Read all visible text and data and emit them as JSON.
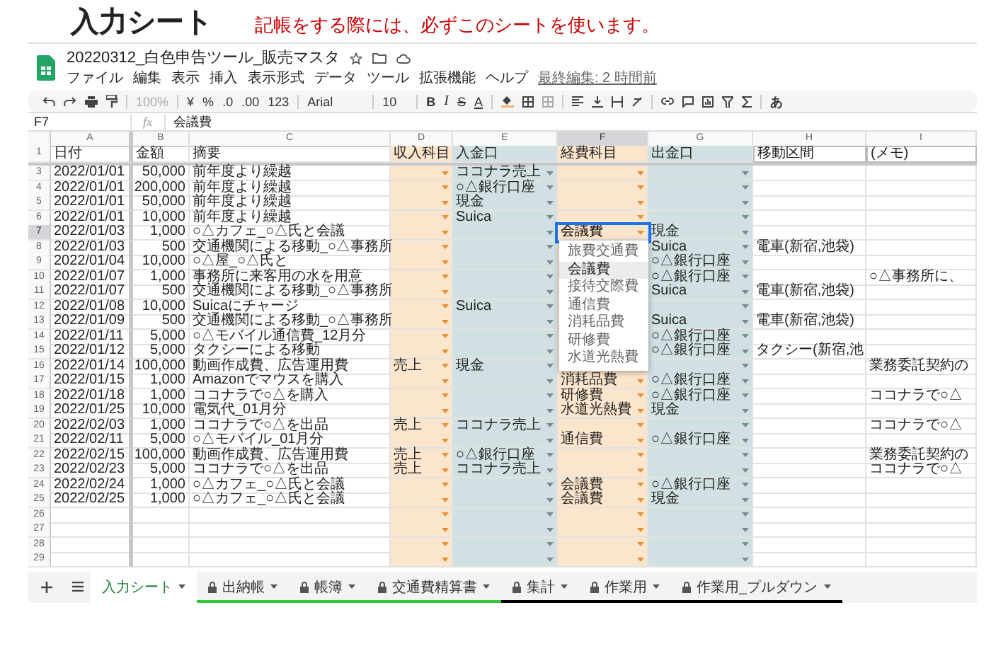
{
  "page": {
    "title": "入力シート",
    "notice": "記帳をする際には、必ずこのシートを使います。"
  },
  "app": {
    "doc_title": "20220312_白色申告ツール_販売マスタ",
    "menu": [
      "ファイル",
      "編集",
      "表示",
      "挿入",
      "表示形式",
      "データ",
      "ツール",
      "拡張機能",
      "ヘルプ"
    ],
    "last_edit": "最終編集: 2 時間前"
  },
  "toolbar": {
    "zoom": "100%",
    "currency": "¥",
    "percent": "%",
    "dec_less": ".0",
    "dec_more": ".00",
    "format": "123",
    "font": "Arial",
    "size": "10",
    "bold": "B",
    "italic": "I",
    "strike": "S",
    "text_color": "A",
    "input_tool": "あ"
  },
  "formula_bar": {
    "cell": "F7",
    "fx": "fx",
    "value": "会議費"
  },
  "sheet": {
    "columns": [
      {
        "letter": "A",
        "selected": false
      },
      {
        "letter": "B",
        "selected": false
      },
      {
        "letter": "C",
        "selected": false
      },
      {
        "letter": "D",
        "selected": false
      },
      {
        "letter": "E",
        "selected": false
      },
      {
        "letter": "F",
        "selected": true
      },
      {
        "letter": "G",
        "selected": false
      },
      {
        "letter": "H",
        "selected": false
      },
      {
        "letter": "I",
        "selected": false
      }
    ],
    "header_row": {
      "num": "1",
      "cells": [
        "日付",
        "金額",
        "摘要",
        "収入科目",
        "入金口",
        "経費科目",
        "出金口",
        "移動区間",
        "(メモ)"
      ]
    },
    "rows": [
      {
        "num": "3",
        "selected": false,
        "date": "2022/01/01",
        "amount": "50,000",
        "summary": "前年度より繰越",
        "deposit": "ココナラ売上"
      },
      {
        "num": "4",
        "selected": false,
        "date": "2022/01/01",
        "amount": "200,000",
        "summary": "前年度より繰越",
        "deposit": "○△銀行口座"
      },
      {
        "num": "5",
        "selected": false,
        "date": "2022/01/01",
        "amount": "50,000",
        "summary": "前年度より繰越",
        "deposit": "現金"
      },
      {
        "num": "6",
        "selected": false,
        "date": "2022/01/01",
        "amount": "10,000",
        "summary": "前年度より繰越",
        "deposit": "Suica"
      },
      {
        "num": "7",
        "selected": true,
        "date": "2022/01/03",
        "amount": "1,000",
        "summary": "○△カフェ_○△氏と会議",
        "expense": "会議費",
        "withdraw": "現金"
      },
      {
        "num": "8",
        "selected": false,
        "date": "2022/01/03",
        "amount": "500",
        "summary": "交通機関による移動_○△事務所",
        "withdraw": "Suica",
        "route": "電車(新宿,池袋)"
      },
      {
        "num": "9",
        "selected": false,
        "date": "2022/01/04",
        "amount": "10,000",
        "summary": "○△屋_○△氏と",
        "withdraw": "○△銀行口座"
      },
      {
        "num": "10",
        "selected": false,
        "date": "2022/01/07",
        "amount": "1,000",
        "summary": "事務所に来客用の水を用意",
        "withdraw": "○△銀行口座",
        "memo": "○△事務所に、"
      },
      {
        "num": "11",
        "selected": false,
        "date": "2022/01/07",
        "amount": "500",
        "summary": "交通機関による移動_○△事務所",
        "withdraw": "Suica",
        "route": "電車(新宿,池袋)"
      },
      {
        "num": "12",
        "selected": false,
        "date": "2022/01/08",
        "amount": "10,000",
        "summary": "Suicaにチャージ",
        "deposit": "Suica"
      },
      {
        "num": "13",
        "selected": false,
        "date": "2022/01/09",
        "amount": "500",
        "summary": "交通機関による移動_○△事務所",
        "withdraw": "Suica",
        "route": "電車(新宿,池袋)"
      },
      {
        "num": "14",
        "selected": false,
        "date": "2022/01/11",
        "amount": "5,000",
        "summary": "○△モバイル通信費_12月分",
        "withdraw": "○△銀行口座"
      },
      {
        "num": "15",
        "selected": false,
        "date": "2022/01/12",
        "amount": "5,000",
        "summary": "タクシーによる移動",
        "withdraw": "○△銀行口座",
        "route": "タクシー(新宿,池"
      },
      {
        "num": "16",
        "selected": false,
        "date": "2022/01/14",
        "amount": "100,000",
        "summary": "動画作成費、広告運用費",
        "income": "売上",
        "deposit": "現金",
        "memo": "業務委託契約の"
      },
      {
        "num": "17",
        "selected": false,
        "date": "2022/01/15",
        "amount": "1,000",
        "summary": "Amazonでマウスを購入",
        "expense": "消耗品費",
        "withdraw": "○△銀行口座"
      },
      {
        "num": "18",
        "selected": false,
        "date": "2022/01/18",
        "amount": "1,000",
        "summary": "ココナラで○△を購入",
        "expense": "研修費",
        "withdraw": "○△銀行口座",
        "memo": "ココナラで○△"
      },
      {
        "num": "19",
        "selected": false,
        "date": "2022/01/25",
        "amount": "10,000",
        "summary": "電気代_01月分",
        "expense": "水道光熱費",
        "withdraw": "現金"
      },
      {
        "num": "20",
        "selected": false,
        "date": "2022/02/03",
        "amount": "1,000",
        "summary": "ココナラで○△を出品",
        "income": "売上",
        "deposit": "ココナラ売上",
        "memo": "ココナラで○△"
      },
      {
        "num": "21",
        "selected": false,
        "date": "2022/02/11",
        "amount": "5,000",
        "summary": "○△モバイル_01月分",
        "expense": "通信費",
        "withdraw": "○△銀行口座"
      },
      {
        "num": "22",
        "selected": false,
        "date": "2022/02/15",
        "amount": "100,000",
        "summary": "動画作成費、広告運用費",
        "income": "売上",
        "deposit": "○△銀行口座",
        "memo": "業務委託契約の"
      },
      {
        "num": "23",
        "selected": false,
        "date": "2022/02/23",
        "amount": "5,000",
        "summary": "ココナラで○△を出品",
        "income": "売上",
        "deposit": "ココナラ売上",
        "memo": "ココナラで○△"
      },
      {
        "num": "24",
        "selected": false,
        "date": "2022/02/24",
        "amount": "1,000",
        "summary": "○△カフェ_○△氏と会議",
        "expense": "会議費",
        "withdraw": "○△銀行口座"
      },
      {
        "num": "25",
        "selected": false,
        "date": "2022/02/25",
        "amount": "1,000",
        "summary": "○△カフェ_○△氏と会議",
        "expense": "会議費",
        "withdraw": "現金"
      },
      {
        "num": "26",
        "selected": false
      },
      {
        "num": "27",
        "selected": false
      },
      {
        "num": "28",
        "selected": false
      },
      {
        "num": "29",
        "selected": false
      }
    ],
    "dropdown": [
      {
        "label": "旅費交通費",
        "highlighted": false
      },
      {
        "label": "会議費",
        "highlighted": true
      },
      {
        "label": "接待交際費",
        "highlighted": false
      },
      {
        "label": "通信費",
        "highlighted": false
      },
      {
        "label": "消耗品費",
        "highlighted": false
      },
      {
        "label": "研修費",
        "highlighted": false
      },
      {
        "label": "水道光熱費",
        "highlighted": false
      }
    ]
  },
  "tabs": [
    {
      "label": "入力シート",
      "selected": true,
      "locked": false
    },
    {
      "label": "出納帳",
      "selected": false,
      "locked": true,
      "color": "#34c934"
    },
    {
      "label": "帳簿",
      "selected": false,
      "locked": true,
      "color": "#34c934"
    },
    {
      "label": "交通費精算書",
      "selected": false,
      "locked": true,
      "color": "#34c934"
    },
    {
      "label": "集計",
      "selected": false,
      "locked": true,
      "color": "#000000"
    },
    {
      "label": "作業用",
      "selected": false,
      "locked": true,
      "color": "#000000"
    },
    {
      "label": "作業用_プルダウン",
      "selected": false,
      "locked": true,
      "color": "#000000"
    }
  ]
}
